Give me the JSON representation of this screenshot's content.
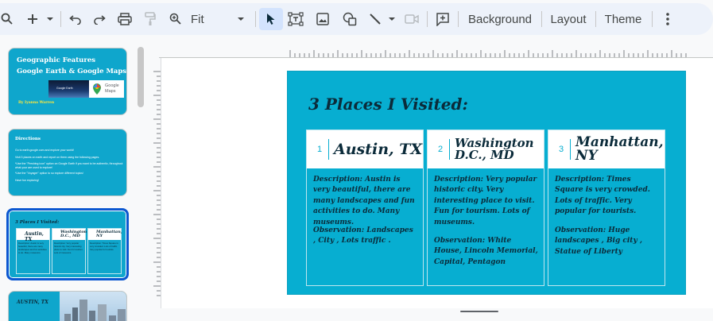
{
  "toolbar": {
    "zoom_value": "Fit",
    "background_label": "Background",
    "layout_label": "Layout",
    "theme_label": "Theme"
  },
  "filmstrip": {
    "slides": [
      {
        "title_line1": "Geographic Features",
        "title_line2": "Google Earth & Google Maps",
        "author": "By Iyanna Warren",
        "image_earth_label": "Google Earth",
        "image_maps_label": "Google Maps"
      },
      {
        "title": "Directions",
        "lines": [
          "Go to earth.google.com and explore your world!",
          "Visit 3 places on earth and report on them using the following pages.",
          "*Use the \"Pershing icon\" option on Google Earth if you want to be authentic, throughout what your are used to explore!",
          "*Use the \"Voyager\" option to so explore different topics!",
          "Have fun exploring!"
        ]
      },
      {
        "title": "3 Places I Visited:"
      },
      {
        "title": "AUSTIN, TX"
      }
    ]
  },
  "slide": {
    "title": "3 Places I Visited:",
    "places": [
      {
        "number": "1",
        "name": "Austin, TX",
        "description": "Description:  Austin is very beautiful, there are many landscapes and fun activities to do. Many museums.",
        "observation": "Observation:  Landscapes , City , Lots traffic ."
      },
      {
        "number": "2",
        "name": "Washington D.C., MD",
        "description": "Description:  Very popular historic city. Very interesting place to visit. Fun for tourism. Lots of museums.",
        "observation": "Observation: White House, Lincoln Memorial, Capital, Pentagon"
      },
      {
        "number": "3",
        "name": "Manhattan, NY",
        "description": "Description:  Times Square is very crowded. Lots of traffic. Very popular for tourists.",
        "observation": "Observation:  Huge landscapes , Big city , Statue of Liberty"
      }
    ]
  },
  "colors": {
    "slide_bg": "#07aed1",
    "accent": "#0b57d0",
    "toolbar_bg": "#edf2fa"
  },
  "icons": [
    "search-icon",
    "add-icon",
    "undo-icon",
    "redo-icon",
    "print-icon",
    "paint-format-icon",
    "zoom-icon",
    "cursor-icon",
    "text-box-icon",
    "image-icon",
    "shape-icon",
    "line-icon",
    "video-icon",
    "comment-icon",
    "more-icon"
  ]
}
